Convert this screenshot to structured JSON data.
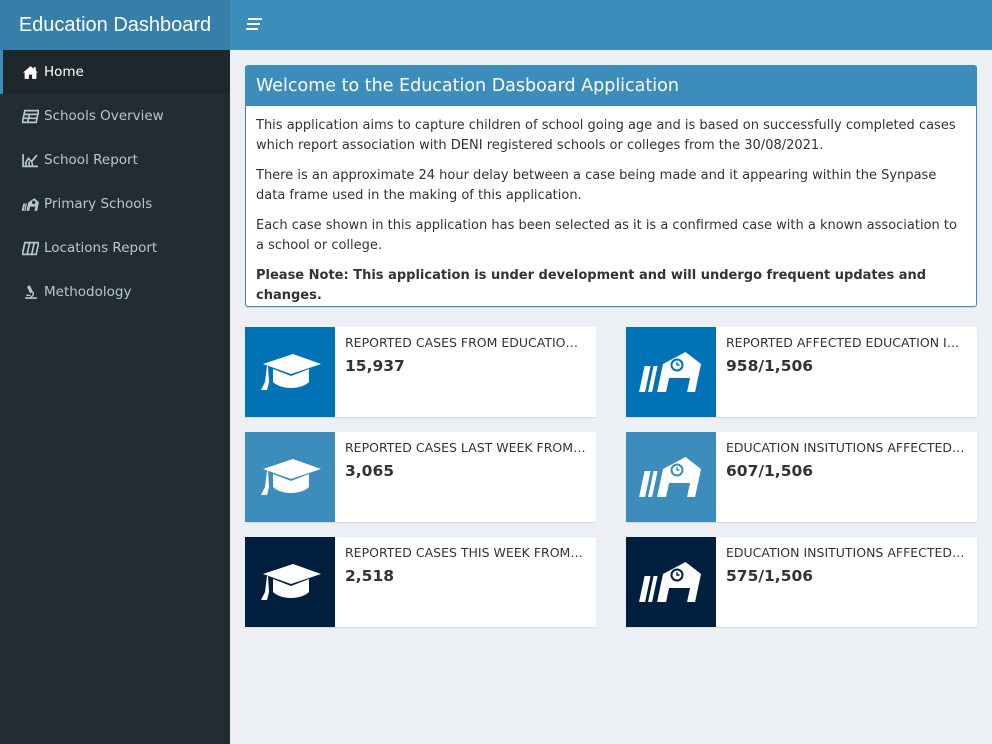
{
  "header": {
    "logo": "Education Dashboard",
    "navbar_color": "#3c8dbc",
    "logo_color": "#367fa9"
  },
  "sidebar": {
    "items": [
      {
        "label": "Home",
        "icon": "home-icon",
        "active": true
      },
      {
        "label": "Schools Overview",
        "icon": "table-icon",
        "active": false
      },
      {
        "label": "School Report",
        "icon": "line-chart-icon",
        "active": false
      },
      {
        "label": "Primary Schools",
        "icon": "school-icon",
        "active": false
      },
      {
        "label": "Locations Report",
        "icon": "map-icon",
        "active": false
      },
      {
        "label": "Methodology",
        "icon": "microscope-icon",
        "active": false
      }
    ]
  },
  "welcome": {
    "title": "Welcome to the Education Dasboard Application",
    "paragraphs": [
      "This application aims to capture children of school going age and is based on successfully completed cases which report association with DENI registered schools or colleges from the 30/08/2021.",
      "There is an approximate 24 hour delay between a case being made and it appearing within the Synpase data frame used in the making of this application.",
      "Each case shown in this application has been selected as it is a confirmed case with a known association to a school or college."
    ],
    "note": "Please Note: This application is under development and will undergo frequent updates and changes."
  },
  "info_boxes": [
    {
      "label": "REPORTED CASES FROM EDUCATION INSTITUTIONS",
      "value": "15,937",
      "icon": "graduation-cap-icon",
      "color": "#0073b7"
    },
    {
      "label": "REPORTED AFFECTED EDUCATION INSTITUTIONS",
      "value": "958/1,506",
      "icon": "school-icon",
      "color": "#0073b7"
    },
    {
      "label": "REPORTED CASES LAST WEEK FROM EDUCATION INSTITUTIONS",
      "value": "3,065",
      "icon": "graduation-cap-icon",
      "color": "#3c8dbc"
    },
    {
      "label": "EDUCATION INSITUTIONS AFFECTED LAST WEEK",
      "value": "607/1,506",
      "icon": "school-icon",
      "color": "#3c8dbc"
    },
    {
      "label": "REPORTED CASES THIS WEEK FROM EDUCATION INSTITUTIONS",
      "value": "2,518",
      "icon": "graduation-cap-icon",
      "color": "#001f3f"
    },
    {
      "label": "EDUCATION INSITUTIONS AFFECTED THIS WEEK",
      "value": "575/1,506",
      "icon": "school-icon",
      "color": "#001f3f"
    }
  ]
}
